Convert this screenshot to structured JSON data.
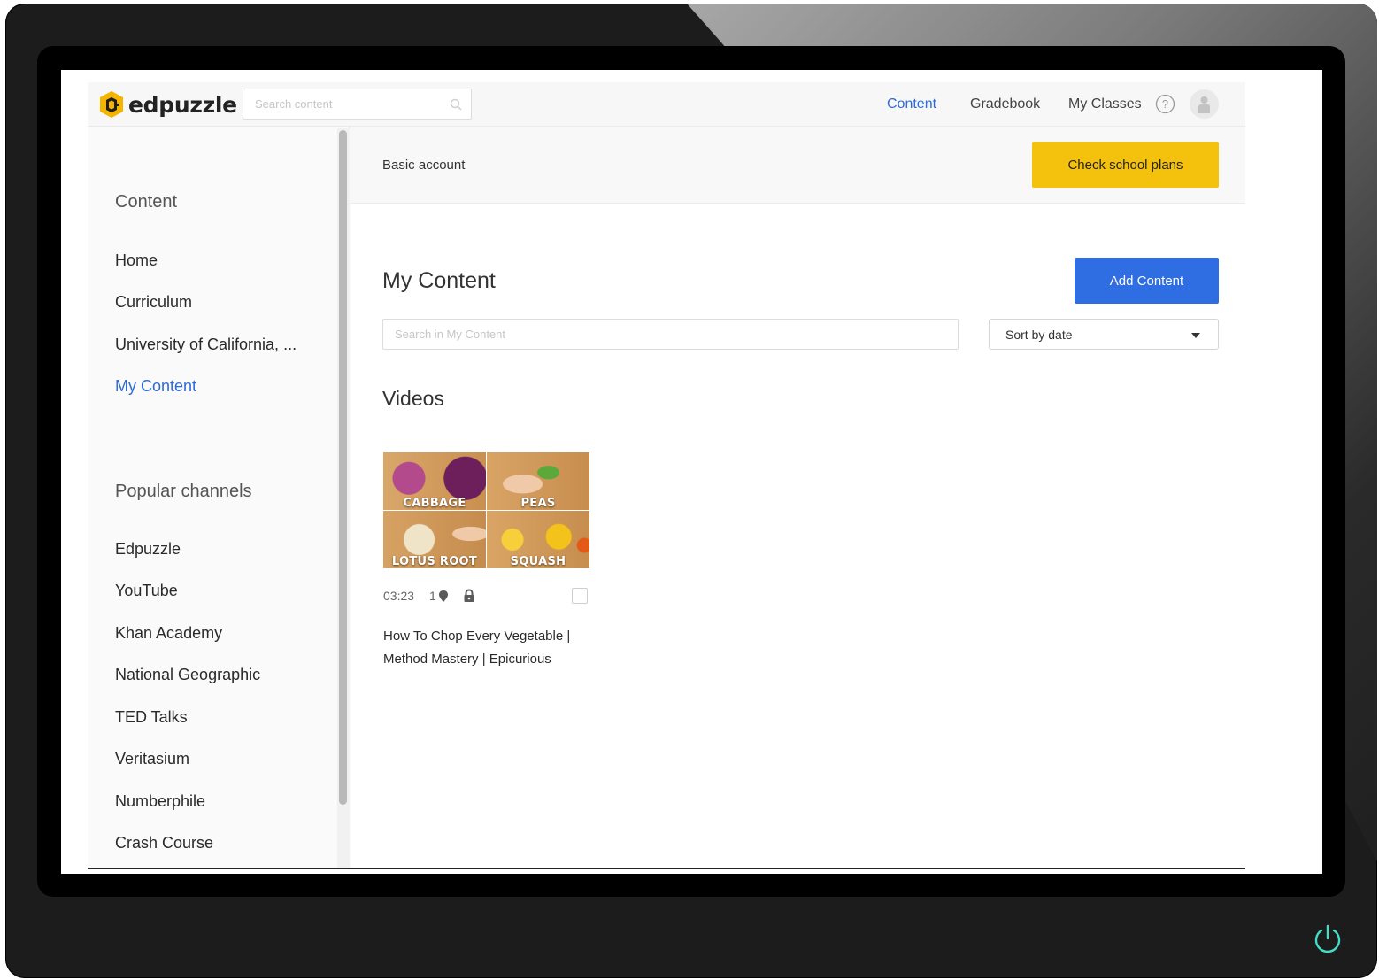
{
  "app": {
    "logo_text": "edpuzzle",
    "search_placeholder": "Search content"
  },
  "nav": {
    "content": "Content",
    "gradebook": "Gradebook",
    "my_classes": "My Classes"
  },
  "sidebar": {
    "content_heading": "Content",
    "content_items": [
      {
        "label": "Home",
        "active": false
      },
      {
        "label": "Curriculum",
        "active": false
      },
      {
        "label": "University of California, ...",
        "active": false
      },
      {
        "label": "My Content",
        "active": true
      }
    ],
    "channels_heading": "Popular channels",
    "channel_items": [
      {
        "label": "Edpuzzle"
      },
      {
        "label": "YouTube"
      },
      {
        "label": "Khan Academy"
      },
      {
        "label": "National Geographic"
      },
      {
        "label": "TED Talks"
      },
      {
        "label": "Veritasium"
      },
      {
        "label": "Numberphile"
      },
      {
        "label": "Crash Course"
      }
    ]
  },
  "banner": {
    "text": "Basic account",
    "button_label": "Check school plans"
  },
  "main": {
    "title": "My Content",
    "add_button": "Add Content",
    "search_placeholder": "Search in My Content",
    "sort_label": "Sort by date",
    "videos_heading": "Videos"
  },
  "video": {
    "thumb_labels": [
      "CABBAGE",
      "PEAS",
      "LOTUS ROOT",
      "SQUASH"
    ],
    "duration": "03:23",
    "question_count": "1",
    "title": "How To Chop Every Vegetable | Method Mastery | Epicurious"
  },
  "colors": {
    "accent_blue": "#2e6ad8",
    "button_blue": "#2f6ee2",
    "plans_yellow": "#f4c20d",
    "power_icon": "#3fe0c5"
  },
  "icons": [
    "puzzle-logo-icon",
    "search-icon",
    "help-icon",
    "avatar-icon",
    "pin-icon",
    "lock-icon",
    "chevron-down-icon",
    "power-icon"
  ]
}
